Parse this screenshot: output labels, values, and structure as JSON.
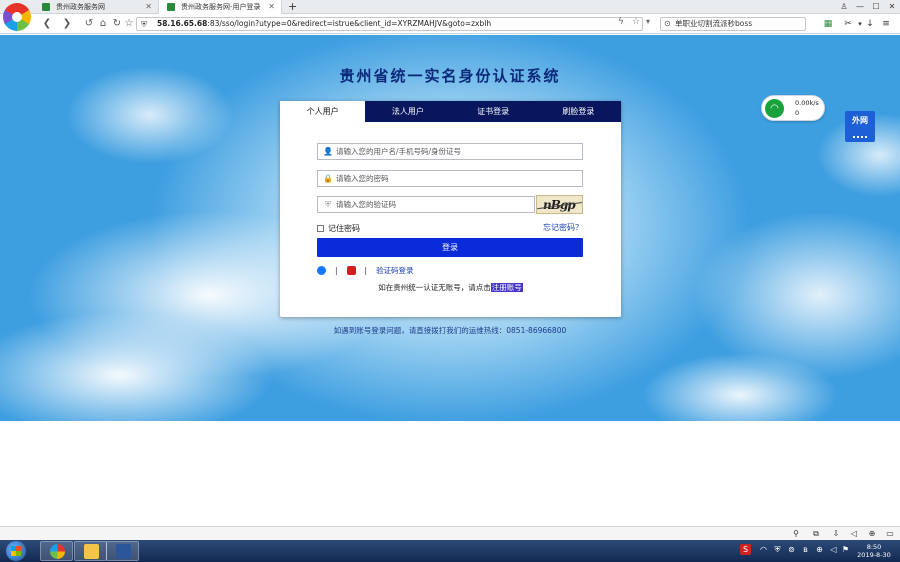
{
  "browser": {
    "tabs": [
      {
        "label": "贵州政务服务网"
      },
      {
        "label": "贵州政务服务网-用户登录"
      }
    ],
    "new_tab": "+",
    "url_host": "58.16.65.68",
    "url_rest": ":83/sso/login?utype=0&redirect=istrue&client_id=XYRZMAHJV&goto=zxblh",
    "search_text": "单职业切割流派秒boss",
    "window_controls": {
      "minimize": "—",
      "maximize": "☐",
      "close": "✕"
    }
  },
  "page": {
    "title": "贵州省统一实名身份认证系统",
    "login_tabs": [
      "个人用户",
      "法人用户",
      "证书登录",
      "刷脸登录"
    ],
    "active_tab": 0,
    "username_placeholder": "请输入您的用户名/手机号码/身份证号",
    "password_placeholder": "请输入您的密码",
    "captcha_placeholder": "请输入您的验证码",
    "captcha_text": "nBgp",
    "remember_label": "记住密码",
    "forgot_link": "忘记密码？",
    "login_button": "登录",
    "sms_login_link": "验证码登录",
    "register_prefix": "如在贵州统一认证无账号，请点击",
    "register_link": "注册账号",
    "hotline": "如遇到账号登录问题，请直接拨打我们的运维热线：0851-86966800"
  },
  "net_widget": {
    "upload": "0.00k/s",
    "download": "0"
  },
  "waiwang_label": "外网",
  "taskbar": {
    "time": "8:50",
    "date": "2019-8-30"
  },
  "colors": {
    "tab_bar_bg": "#08165e",
    "login_button": "#0c2bd8",
    "title": "#0b2a7a",
    "link": "#1a3fae"
  },
  "icons": [
    "back-icon",
    "forward-icon",
    "home-icon",
    "refresh-icon",
    "star-icon",
    "shield-icon",
    "user-icon",
    "lock-icon",
    "shield-check-icon",
    "alipay-icon",
    "wechat-icon",
    "wifi-icon",
    "windows-start-icon"
  ]
}
